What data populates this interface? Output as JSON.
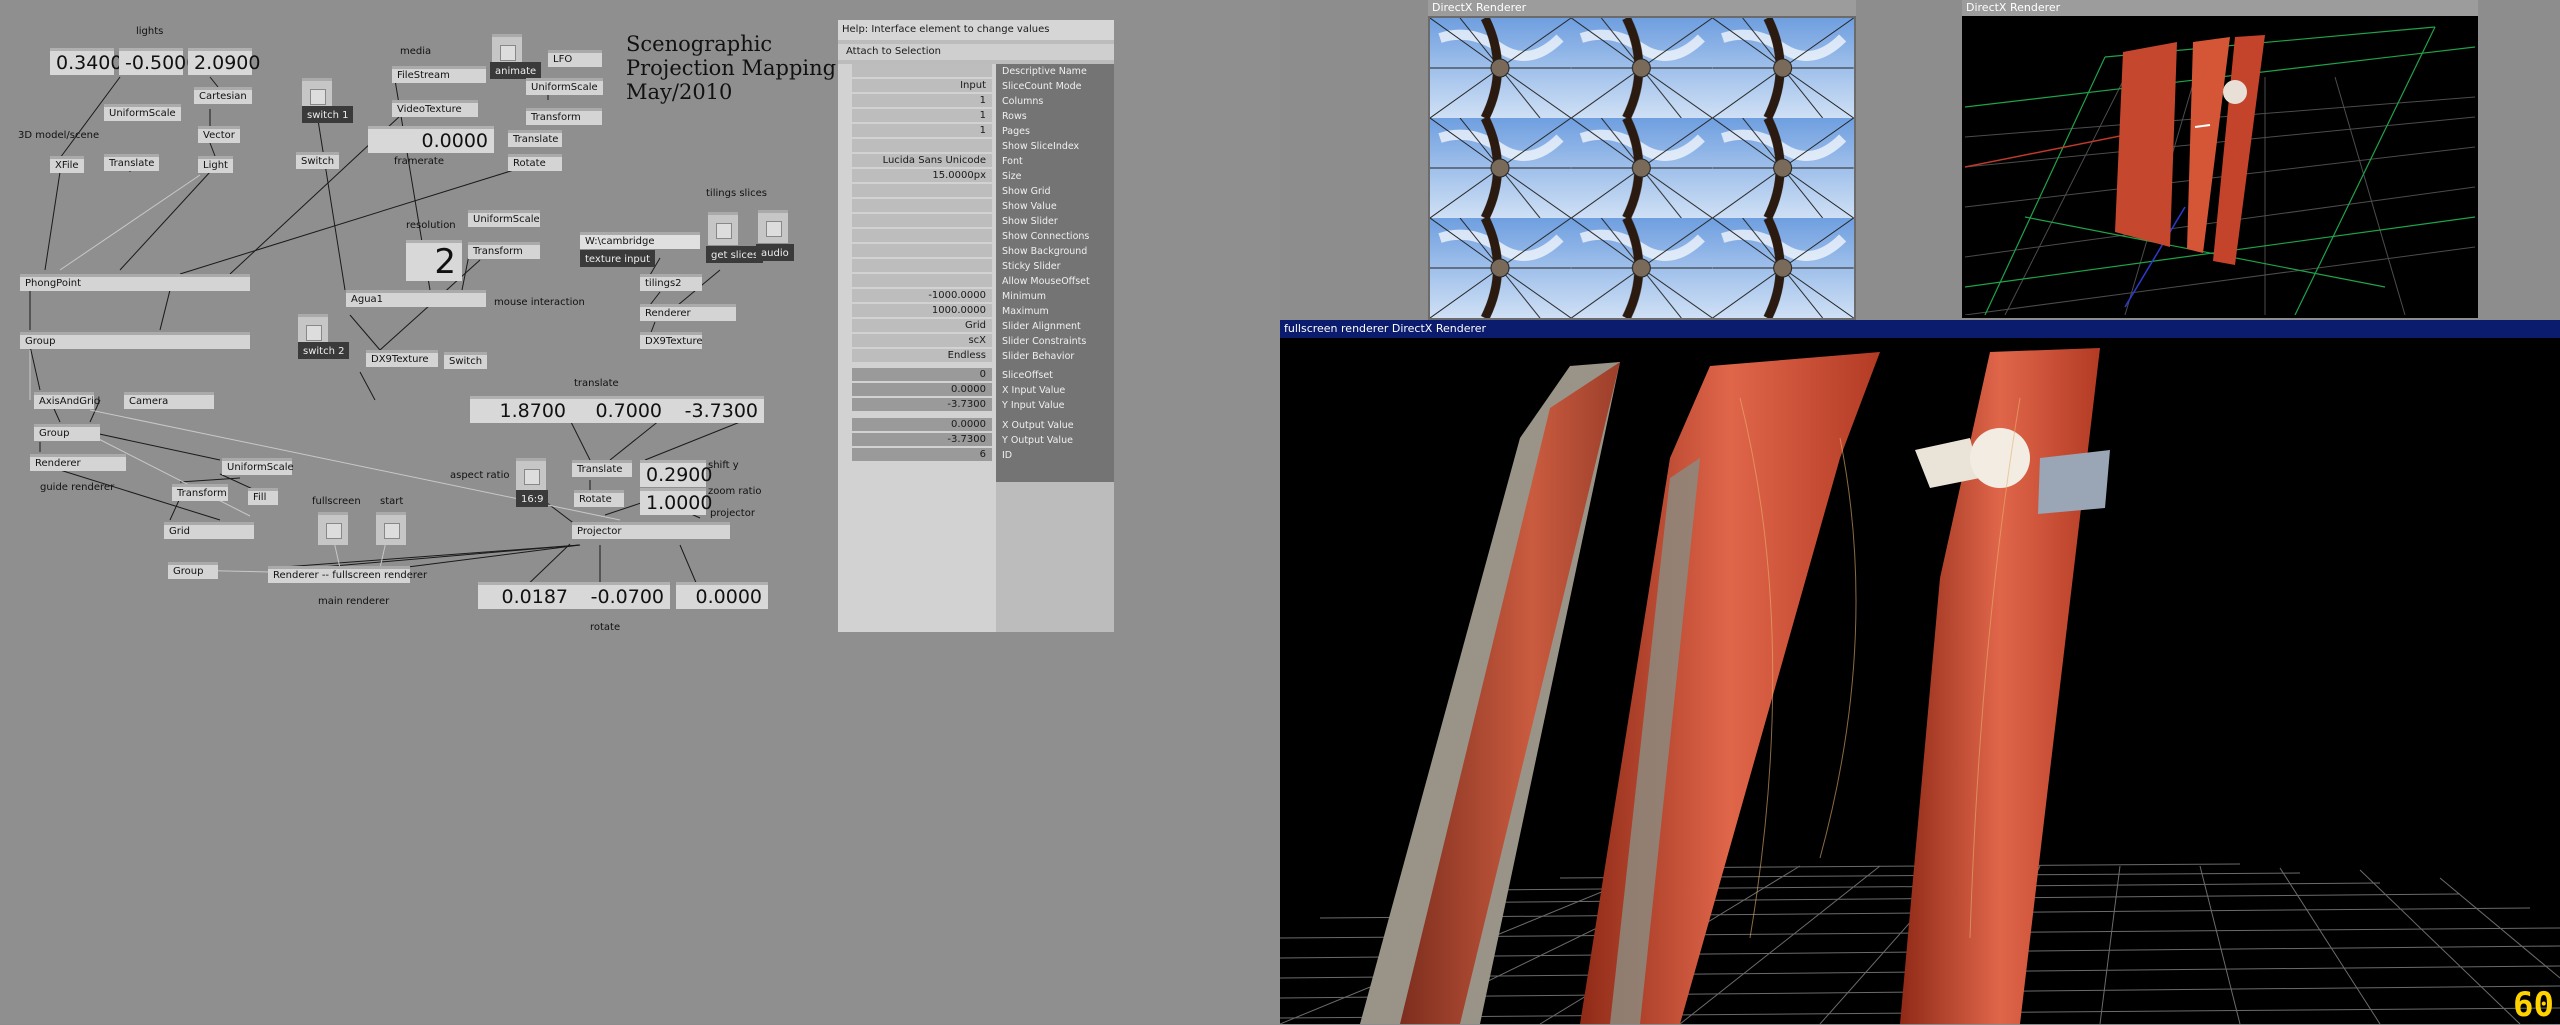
{
  "title_lines": [
    "Scenographic",
    "Projection Mapping",
    "May/2010"
  ],
  "labels": {
    "lights": "lights",
    "model": "3D model/scene",
    "media": "media",
    "framerate": "framerate",
    "resolution": "resolution",
    "tilings": "tilings slices",
    "mouse": "mouse interaction",
    "translate": "translate",
    "aspect": "aspect ratio",
    "shift_y": "shift y",
    "zoom": "zoom ratio",
    "projector": "projector",
    "fullscreen": "fullscreen",
    "start": "start",
    "guide": "guide renderer",
    "main": "main renderer",
    "rotate": "rotate",
    "path": "W:\\cambridge"
  },
  "numbers": {
    "light1": "0.3400",
    "light2": "-0.5000",
    "light3": "2.0900",
    "framerate": "0.0000",
    "resolution": "2",
    "tx": "1.8700",
    "ty": "0.7000",
    "tz": "-3.7300",
    "shift_y": "0.2900",
    "zoom": "1.0000",
    "rx": "0.0187",
    "ry": "-0.0700",
    "rz": "0.0000"
  },
  "nodes": {
    "cartesian": "Cartesian",
    "vector": "Vector",
    "light": "Light",
    "uniformscale1": "UniformScale",
    "translate1": "Translate",
    "xfile": "XFile",
    "switch1": "switch 1",
    "switch": "Switch",
    "filestream": "FileStream",
    "videotexture": "VideoTexture",
    "animate": "animate",
    "lfo": "LFO",
    "uniformscale2": "UniformScale",
    "transform1": "Transform",
    "translate2": "Translate",
    "rotate1": "Rotate",
    "phongpoint": "PhongPoint",
    "uniformscale3": "UniformScale",
    "transform2": "Transform",
    "agua": "Agua1",
    "switch2": "switch 2",
    "dx9texture1": "DX9Texture",
    "switch3": "Switch",
    "texture_input": "texture input",
    "get_slices": "get slices",
    "audio": "audio",
    "tilings": "tilings2",
    "renderer1": "Renderer",
    "dx9texture2": "DX9Texture",
    "group1": "Group",
    "axisandgrid": "AxisAndGrid",
    "camera": "Camera",
    "group2": "Group",
    "renderer2": "Renderer",
    "uniformscale4": "UniformScale",
    "transform3": "Transform",
    "fill": "Fill",
    "grid": "Grid",
    "group3": "Group",
    "renderer_fs": "Renderer -- fullscreen renderer",
    "translate3": "Translate",
    "rotate2": "Rotate",
    "projector": "Projector",
    "ratio": "16:9"
  },
  "inspector": {
    "header": "Help: Interface element to change values",
    "attach": "Attach to Selection",
    "values": [
      "",
      "Input",
      "1",
      "1",
      "1",
      "",
      "Lucida Sans Unicode",
      "15.0000px",
      "",
      "",
      "",
      "",
      "",
      "",
      "",
      "-1000.0000",
      "1000.0000",
      "Grid",
      "scX",
      "Endless"
    ],
    "names": [
      "Descriptive Name",
      "SliceCount Mode",
      "Columns",
      "Rows",
      "Pages",
      "Show SliceIndex",
      "Font",
      "Size",
      "Show Grid",
      "Show Value",
      "Show Slider",
      "Show Connections",
      "Show Background",
      "Sticky Slider",
      "Allow MouseOffset",
      "Minimum",
      "Maximum",
      "Slider Alignment",
      "Slider Constraints",
      "Slider Behavior"
    ],
    "pin_values": [
      "0",
      "0.0000",
      "-3.7300",
      "0.0000",
      "-3.7300",
      "6"
    ],
    "pin_names": [
      "SliceOffset",
      "X Input Value",
      "Y Input Value",
      "X Output Value",
      "Y Output Value",
      "ID"
    ]
  },
  "windows": {
    "r1_title": "DirectX Renderer",
    "r2_title": "DirectX Renderer",
    "r3_title": "fullscreen renderer   DirectX Renderer",
    "fps": "60"
  },
  "colors": {
    "patch_bg": "#8f8f8f",
    "node_bg": "#d4d4d4",
    "inspector_names_bg": "#747474",
    "renderer_title_grey": "#9c9c9c",
    "renderer_title_blue": "#0b1b6e",
    "fps": "#ffd200",
    "surface_red": "#c8442a",
    "sky": "#8fb4e6"
  }
}
